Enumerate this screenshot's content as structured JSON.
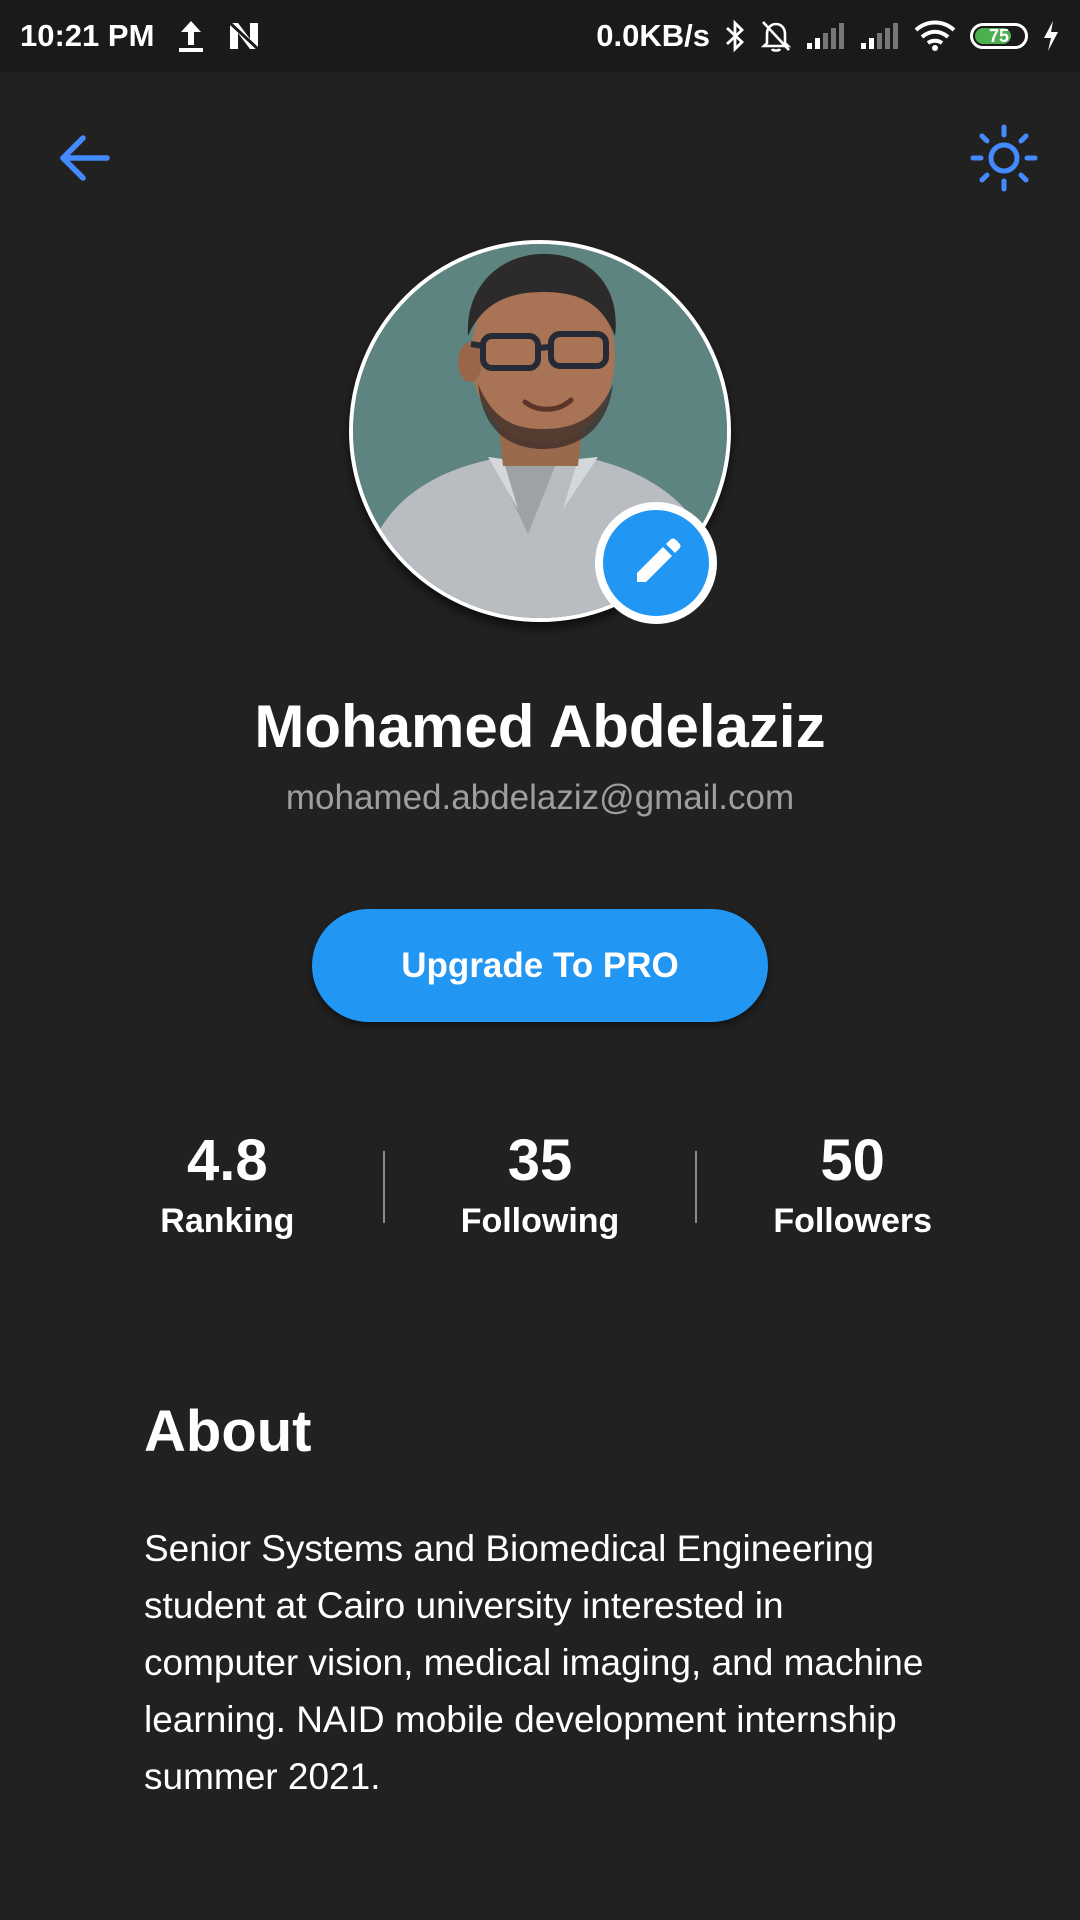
{
  "status_bar": {
    "time": "10:21 PM",
    "network_speed": "0.0KB/s",
    "battery_level": "75",
    "battery_fraction": 0.75,
    "icons": [
      "upload-icon",
      "n-notification-icon",
      "bluetooth-icon",
      "bell-off-icon",
      "signal-icon",
      "signal-icon",
      "wifi-icon",
      "battery-icon",
      "charging-icon"
    ]
  },
  "app_bar": {
    "back_icon": "arrow-left-icon",
    "theme_icon": "sun-icon",
    "accent_color": "#448aff"
  },
  "profile": {
    "name": "Mohamed Abdelaziz",
    "email": "mohamed.abdelaziz@gmail.com",
    "edit_icon": "pencil-icon",
    "upgrade_label": "Upgrade To PRO",
    "primary_color": "#2196f3"
  },
  "stats": [
    {
      "value": "4.8",
      "label": "Ranking"
    },
    {
      "value": "35",
      "label": "Following"
    },
    {
      "value": "50",
      "label": "Followers"
    }
  ],
  "about": {
    "title": "About",
    "text": "Senior Systems and Biomedical Engineering student at Cairo university interested in computer vision, medical imaging, and machine learning. NAID mobile development internship summer 2021."
  }
}
